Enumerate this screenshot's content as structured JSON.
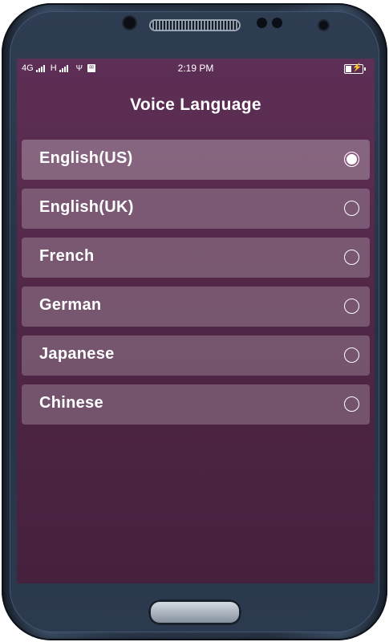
{
  "status_bar": {
    "network_1": "4G",
    "network_2": "H",
    "time": "2:19 PM"
  },
  "page": {
    "title": "Voice Language"
  },
  "languages": [
    {
      "label": "English(US)",
      "selected": true
    },
    {
      "label": "English(UK)",
      "selected": false
    },
    {
      "label": "French",
      "selected": false
    },
    {
      "label": "German",
      "selected": false
    },
    {
      "label": "Japanese",
      "selected": false
    },
    {
      "label": "Chinese",
      "selected": false
    }
  ],
  "colors": {
    "background_top": "#5e2f56",
    "background_bottom": "#45213d",
    "row_background": "rgba(255,255,255,0.22)",
    "text": "#ffffff"
  }
}
